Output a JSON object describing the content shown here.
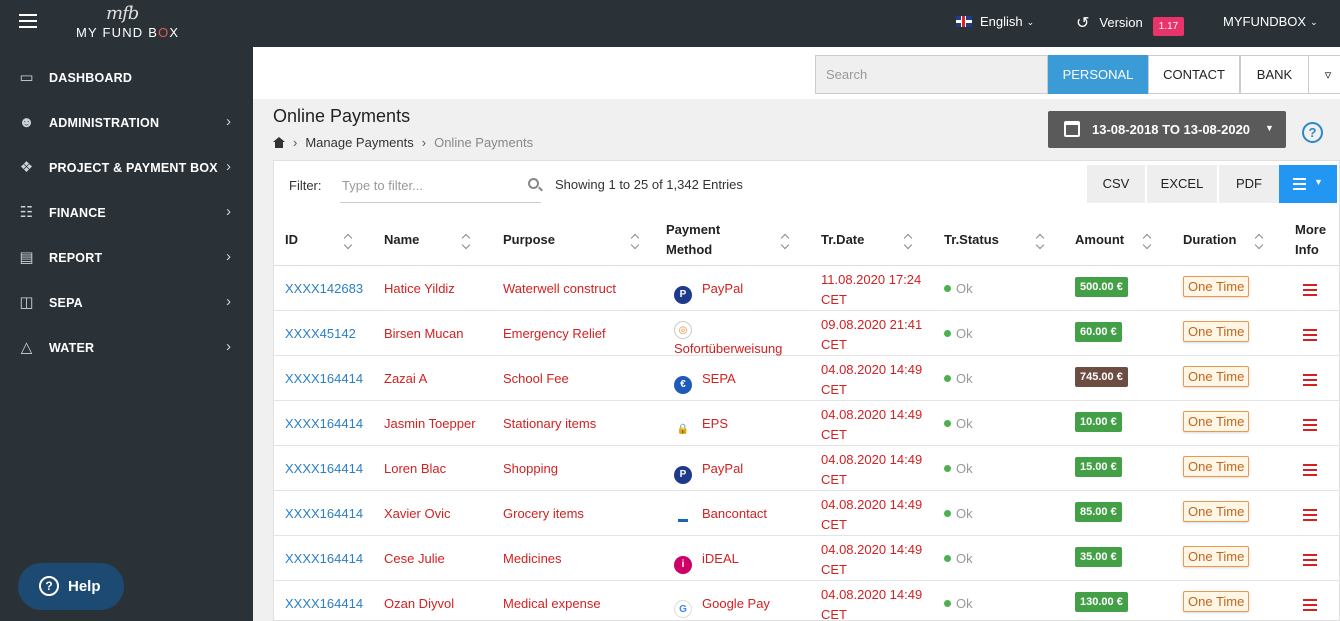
{
  "app": {
    "brand": "MY FUND BOX",
    "brand_prefix": "MY FUND B",
    "brand_o": "O",
    "brand_suffix": "X",
    "brand_script": "mfb"
  },
  "topbar": {
    "language": "English",
    "version_label": "Version",
    "version_badge": "1.17",
    "account": "MYFUNDBOX"
  },
  "sidebar": {
    "items": [
      {
        "label": "DASHBOARD",
        "icon": "monitor-icon",
        "has_arrow": false
      },
      {
        "label": "ADMINISTRATION",
        "icon": "user-lock-icon",
        "has_arrow": true
      },
      {
        "label": "PROJECT & PAYMENT BOX",
        "icon": "puzzle-icon",
        "has_arrow": true
      },
      {
        "label": "FINANCE",
        "icon": "money-icon",
        "has_arrow": true
      },
      {
        "label": "REPORT",
        "icon": "report-icon",
        "has_arrow": true
      },
      {
        "label": "SEPA",
        "icon": "gift-icon",
        "has_arrow": true
      },
      {
        "label": "WATER",
        "icon": "flask-icon",
        "has_arrow": true
      }
    ],
    "help_label": "Help"
  },
  "filterbar": {
    "search_placeholder": "Search",
    "segments": [
      "PERSONAL",
      "CONTACT",
      "BANK"
    ],
    "active_segment": "PERSONAL"
  },
  "page": {
    "title": "Online Payments",
    "breadcrumb": [
      "Manage Payments",
      "Online Payments"
    ],
    "date_range": "13-08-2018 TO 13-08-2020"
  },
  "toolbar": {
    "filter_label": "Filter:",
    "filter_placeholder": "Type to filter...",
    "entries_info": "Showing 1 to 25 of 1,342 Entries",
    "export_buttons": [
      "CSV",
      "EXCEL",
      "PDF"
    ]
  },
  "table": {
    "columns": {
      "id": "ID",
      "name": "Name",
      "purpose": "Purpose",
      "method_l1": "Payment",
      "method_l2": "Method",
      "date": "Tr.Date",
      "status": "Tr.Status",
      "amount": "Amount",
      "duration": "Duration",
      "more_l1": "More",
      "more_l2": "Info"
    },
    "rows": [
      {
        "id": "XXXX142683",
        "name": "Hatice Yildiz",
        "purpose": "Waterwell construct",
        "method": "PayPal",
        "method_icon": "paypal-icon",
        "date_l1": "11.08.2020 17:24",
        "date_l2": "CET",
        "status": "Ok",
        "amount": "500.00 €",
        "amount_color": "#43a047",
        "duration": "One Time"
      },
      {
        "id": "XXXX45142",
        "name": "Birsen Mucan",
        "purpose": "Emergency Relief",
        "method": "Sofortüberweisung",
        "method_icon": "sofort-icon",
        "date_l1": "09.08.2020 21:41",
        "date_l2": "CET",
        "status": "Ok",
        "amount": "60.00 €",
        "amount_color": "#43a047",
        "duration": "One Time"
      },
      {
        "id": "XXXX164414",
        "name": "Zazai A",
        "purpose": "School Fee",
        "method": "SEPA",
        "method_icon": "euro-icon",
        "date_l1": "04.08.2020 14:49",
        "date_l2": "CET",
        "status": "Ok",
        "amount": "745.00 €",
        "amount_color": "#6d4c41",
        "duration": "One Time"
      },
      {
        "id": "XXXX164414",
        "name": "Jasmin Toepper",
        "purpose": "Stationary items",
        "method": "EPS",
        "method_icon": "eps-icon",
        "date_l1": "04.08.2020 14:49",
        "date_l2": "CET",
        "status": "Ok",
        "amount": "10.00 €",
        "amount_color": "#43a047",
        "duration": "One Time"
      },
      {
        "id": "XXXX164414",
        "name": "Loren Blac",
        "purpose": "Shopping",
        "method": "PayPal",
        "method_icon": "paypal-icon",
        "date_l1": "04.08.2020 14:49",
        "date_l2": "CET",
        "status": "Ok",
        "amount": "15.00 €",
        "amount_color": "#43a047",
        "duration": "One Time"
      },
      {
        "id": "XXXX164414",
        "name": "Xavier Ovic",
        "purpose": "Grocery items",
        "method": "Bancontact",
        "method_icon": "bancontact-icon",
        "date_l1": "04.08.2020 14:49",
        "date_l2": "CET",
        "status": "Ok",
        "amount": "85.00 €",
        "amount_color": "#43a047",
        "duration": "One Time"
      },
      {
        "id": "XXXX164414",
        "name": "Cese Julie",
        "purpose": "Medicines",
        "method": "iDEAL",
        "method_icon": "ideal-icon",
        "date_l1": "04.08.2020 14:49",
        "date_l2": "CET",
        "status": "Ok",
        "amount": "35.00 €",
        "amount_color": "#43a047",
        "duration": "One Time"
      },
      {
        "id": "XXXX164414",
        "name": "Ozan Diyvol",
        "purpose": "Medical expense",
        "method": "Google Pay",
        "method_icon": "google-pay-icon",
        "date_l1": "04.08.2020 14:49",
        "date_l2": "CET",
        "status": "Ok",
        "amount": "130.00 €",
        "amount_color": "#43a047",
        "duration": "One Time"
      }
    ]
  }
}
